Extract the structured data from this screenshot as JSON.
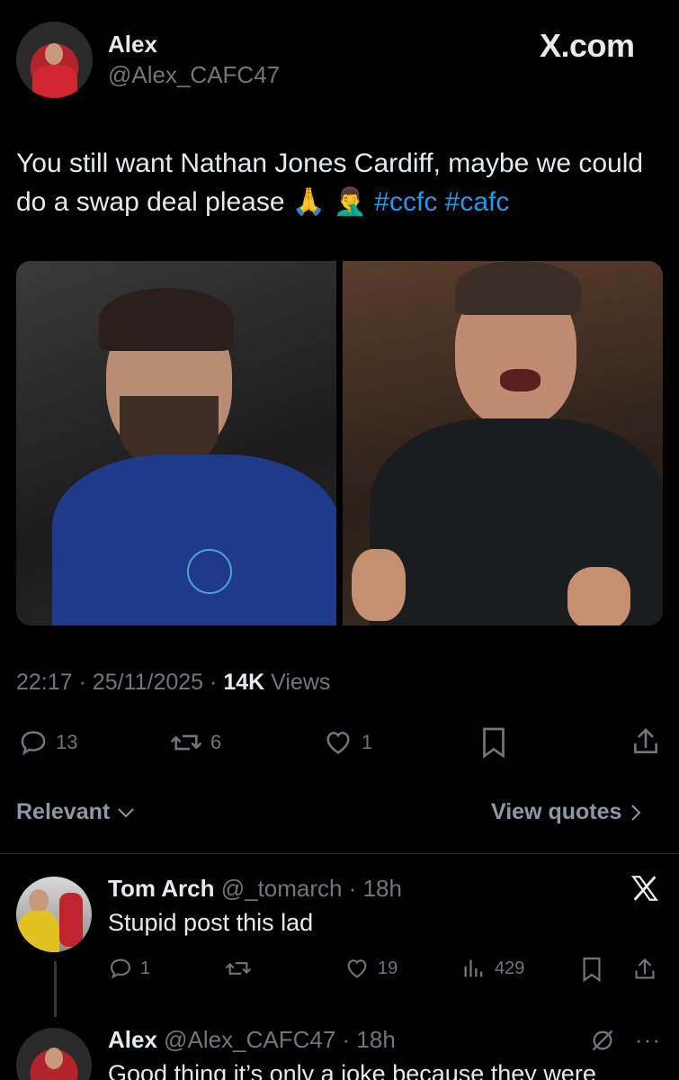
{
  "tweet": {
    "author_name": "Alex",
    "author_handle": "@Alex_CAFC47",
    "brand": "X.com",
    "text": "You still want Nathan Jones Cardiff, maybe we could do a swap deal please",
    "emojis": "🙏 🤦‍♂️",
    "hashtags": "#ccfc #cafc",
    "time": "22:17",
    "date": "25/11/2025",
    "views_count": "14K",
    "views_label": "Views",
    "replies": "13",
    "reposts": "6",
    "likes": "1"
  },
  "sort": {
    "relevant_label": "Relevant",
    "view_quotes_label": "View quotes"
  },
  "replies": [
    {
      "name": "Tom Arch",
      "handle": "@_tomarch",
      "time": "18h",
      "text": "Stupid post this lad",
      "reply_count": "1",
      "like_count": "19",
      "views": "429"
    },
    {
      "name": "Alex",
      "handle": "@Alex_CAFC47",
      "time": "18h",
      "text": "Good thing it’s only a joke because they were"
    }
  ],
  "colors": {
    "accent": "#1d9bf0",
    "muted": "#71767b",
    "background": "#000000"
  },
  "icons": [
    "reply-icon",
    "repost-icon",
    "like-icon",
    "bookmark-icon",
    "share-icon",
    "chevron-down-icon",
    "chevron-right-icon",
    "x-logo-icon",
    "views-icon",
    "more-icon",
    "grok-icon"
  ]
}
